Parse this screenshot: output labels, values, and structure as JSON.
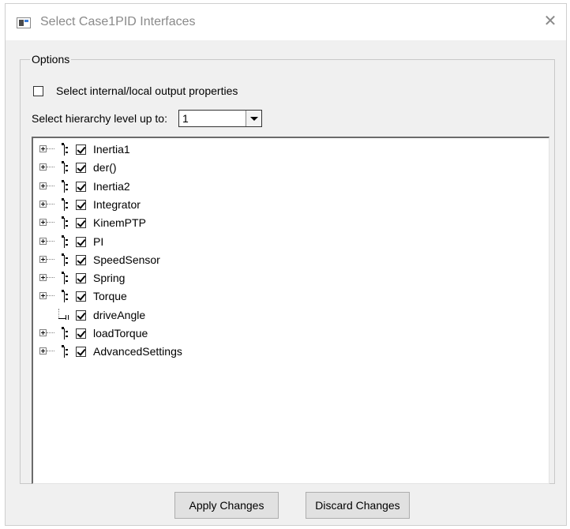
{
  "window": {
    "title": "Select Case1PID Interfaces"
  },
  "options": {
    "legend": "Options",
    "internal_checkbox": {
      "label": "Select internal/local output properties",
      "checked": false
    },
    "hierarchy": {
      "label": "Select hierarchy level up to:",
      "value": "1"
    }
  },
  "tree": {
    "items": [
      {
        "label": "Inertia1",
        "checked": true,
        "kind": "component"
      },
      {
        "label": "der()",
        "checked": true,
        "kind": "component"
      },
      {
        "label": "Inertia2",
        "checked": true,
        "kind": "component"
      },
      {
        "label": "Integrator",
        "checked": true,
        "kind": "component"
      },
      {
        "label": "KinemPTP",
        "checked": true,
        "kind": "component"
      },
      {
        "label": "PI",
        "checked": true,
        "kind": "component"
      },
      {
        "label": "SpeedSensor",
        "checked": true,
        "kind": "component"
      },
      {
        "label": "Spring",
        "checked": true,
        "kind": "component"
      },
      {
        "label": "Torque",
        "checked": true,
        "kind": "component"
      },
      {
        "label": "driveAngle",
        "checked": true,
        "kind": "port"
      },
      {
        "label": "loadTorque",
        "checked": true,
        "kind": "component"
      },
      {
        "label": "AdvancedSettings",
        "checked": true,
        "kind": "component"
      }
    ]
  },
  "buttons": {
    "apply": "Apply Changes",
    "discard": "Discard Changes"
  }
}
